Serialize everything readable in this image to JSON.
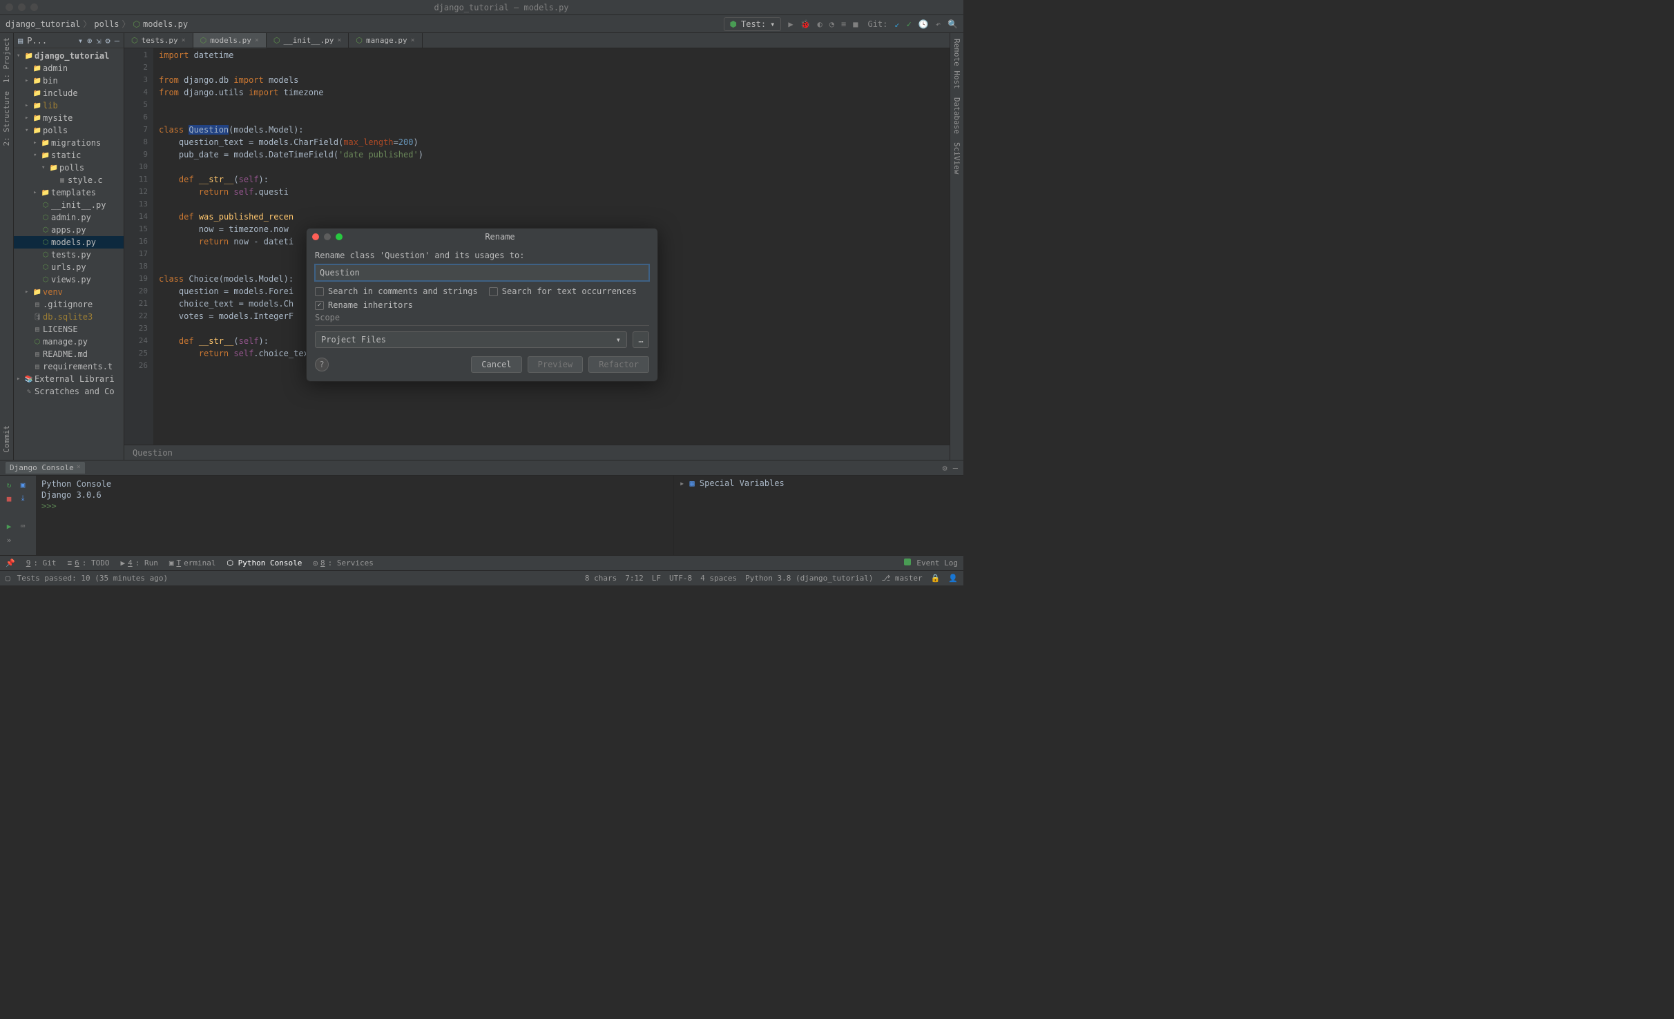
{
  "titlebar": {
    "text": "django_tutorial – models.py"
  },
  "breadcrumbs": [
    "django_tutorial",
    "polls",
    "models.py"
  ],
  "run_config": "Test:",
  "git_label": "Git:",
  "project_tree": [
    {
      "indent": 0,
      "arrow": "▾",
      "icon": "folder",
      "label": "django_tutorial",
      "bold": true
    },
    {
      "indent": 1,
      "arrow": "▸",
      "icon": "folder",
      "label": "admin"
    },
    {
      "indent": 1,
      "arrow": "▸",
      "icon": "folder",
      "label": "bin"
    },
    {
      "indent": 1,
      "arrow": "",
      "icon": "folder",
      "label": "include"
    },
    {
      "indent": 1,
      "arrow": "▸",
      "icon": "folder",
      "label": "lib",
      "cls": "lib"
    },
    {
      "indent": 1,
      "arrow": "▸",
      "icon": "folder",
      "label": "mysite"
    },
    {
      "indent": 1,
      "arrow": "▾",
      "icon": "folder",
      "label": "polls"
    },
    {
      "indent": 2,
      "arrow": "▸",
      "icon": "folder",
      "label": "migrations"
    },
    {
      "indent": 2,
      "arrow": "▾",
      "icon": "folder",
      "label": "static"
    },
    {
      "indent": 3,
      "arrow": "▾",
      "icon": "folder",
      "label": "polls"
    },
    {
      "indent": 4,
      "arrow": "",
      "icon": "css",
      "label": "style.c"
    },
    {
      "indent": 2,
      "arrow": "▸",
      "icon": "folder-p",
      "label": "templates"
    },
    {
      "indent": 2,
      "arrow": "",
      "icon": "py",
      "label": "__init__.py"
    },
    {
      "indent": 2,
      "arrow": "",
      "icon": "py",
      "label": "admin.py"
    },
    {
      "indent": 2,
      "arrow": "",
      "icon": "py",
      "label": "apps.py"
    },
    {
      "indent": 2,
      "arrow": "",
      "icon": "py",
      "label": "models.py",
      "selected": true
    },
    {
      "indent": 2,
      "arrow": "",
      "icon": "py",
      "label": "tests.py"
    },
    {
      "indent": 2,
      "arrow": "",
      "icon": "py",
      "label": "urls.py"
    },
    {
      "indent": 2,
      "arrow": "",
      "icon": "py",
      "label": "views.py"
    },
    {
      "indent": 1,
      "arrow": "▸",
      "icon": "folder",
      "label": "venv",
      "cls": "venv"
    },
    {
      "indent": 1,
      "arrow": "",
      "icon": "file",
      "label": ".gitignore"
    },
    {
      "indent": 1,
      "arrow": "",
      "icon": "db",
      "label": "db.sqlite3",
      "cls": "db"
    },
    {
      "indent": 1,
      "arrow": "",
      "icon": "file",
      "label": "LICENSE"
    },
    {
      "indent": 1,
      "arrow": "",
      "icon": "py",
      "label": "manage.py"
    },
    {
      "indent": 1,
      "arrow": "",
      "icon": "md",
      "label": "README.md"
    },
    {
      "indent": 1,
      "arrow": "",
      "icon": "file",
      "label": "requirements.t"
    },
    {
      "indent": 0,
      "arrow": "▸",
      "icon": "lib",
      "label": "External Librari"
    },
    {
      "indent": 0,
      "arrow": "",
      "icon": "scratch",
      "label": "Scratches and Co"
    }
  ],
  "editor_tabs": [
    {
      "label": "tests.py",
      "active": false
    },
    {
      "label": "models.py",
      "active": true
    },
    {
      "label": "__init__.py",
      "active": false
    },
    {
      "label": "manage.py",
      "active": false
    }
  ],
  "code_lines": [
    [
      "<span class='kw'>import</span> datetime"
    ],
    [
      ""
    ],
    [
      "<span class='kw'>from</span> django.db <span class='kw'>import</span> models"
    ],
    [
      "<span class='kw'>from</span> django.utils <span class='kw'>import</span> timezone"
    ],
    [
      ""
    ],
    [
      ""
    ],
    [
      "<span class='kw'>class</span> <span class='hl clname'>Question</span>(models.Model):"
    ],
    [
      "    question_text = models.CharField(<span class='param'>max_length</span>=<span class='num'>200</span>)"
    ],
    [
      "    pub_date = models.DateTimeField(<span class='str'>'date published'</span>)"
    ],
    [
      ""
    ],
    [
      "    <span class='kw'>def</span> <span class='defname'>__str__</span>(<span class='self'>self</span>):"
    ],
    [
      "        <span class='kw'>return</span> <span class='self'>self</span>.questi"
    ],
    [
      ""
    ],
    [
      "    <span class='kw'>def</span> <span class='defname'>was_published_recen</span>"
    ],
    [
      "        now = timezone.now"
    ],
    [
      "        <span class='kw'>return</span> now - dateti"
    ],
    [
      ""
    ],
    [
      ""
    ],
    [
      "<span class='kw'>class</span> <span class='clname'>Choice</span>(models.Model):"
    ],
    [
      "    question = models.Forei"
    ],
    [
      "    choice_text = models.Ch"
    ],
    [
      "    votes = models.IntegerF"
    ],
    [
      ""
    ],
    [
      "    <span class='kw'>def</span> <span class='defname'>__str__</span>(<span class='self'>self</span>):"
    ],
    [
      "        <span class='kw'>return</span> <span class='self'>self</span>.choice_text"
    ],
    [
      ""
    ]
  ],
  "breadcrumb_bottom": "Question",
  "console": {
    "title": "Django Console",
    "lines": [
      "Python Console",
      "Django 3.0.6",
      "",
      ">>>"
    ],
    "vars_label": "Special Variables"
  },
  "project_header": {
    "title": "P..."
  },
  "left_tools": [
    "1: Project",
    "2: Structure",
    "Commit"
  ],
  "right_tools": [
    "Remote Host",
    "Database",
    "SciView"
  ],
  "bottom_tools": [
    {
      "label": "9: Git",
      "u": "9"
    },
    {
      "label": "6: TODO",
      "u": "6"
    },
    {
      "label": "4: Run",
      "u": "4",
      "icon": "▶"
    },
    {
      "label": "Terminal",
      "u": "T"
    },
    {
      "label": "Python Console",
      "active": true
    },
    {
      "label": "8: Services",
      "u": "8"
    }
  ],
  "event_log": "Event Log",
  "status": {
    "left": "Tests passed: 10 (35 minutes ago)",
    "chars": "8 chars",
    "pos": "7:12",
    "le": "LF",
    "enc": "UTF-8",
    "indent": "4 spaces",
    "interp": "Python 3.8 (django_tutorial)",
    "branch": "master"
  },
  "dialog": {
    "title": "Rename",
    "prompt": "Rename class 'Question' and its usages to:",
    "value": "Question",
    "check1": "Search in comments and strings",
    "check2": "Search for text occurrences",
    "check3": "Rename inheritors",
    "scope_label": "Scope",
    "scope_value": "Project Files",
    "cancel": "Cancel",
    "preview": "Preview",
    "refactor": "Refactor"
  }
}
